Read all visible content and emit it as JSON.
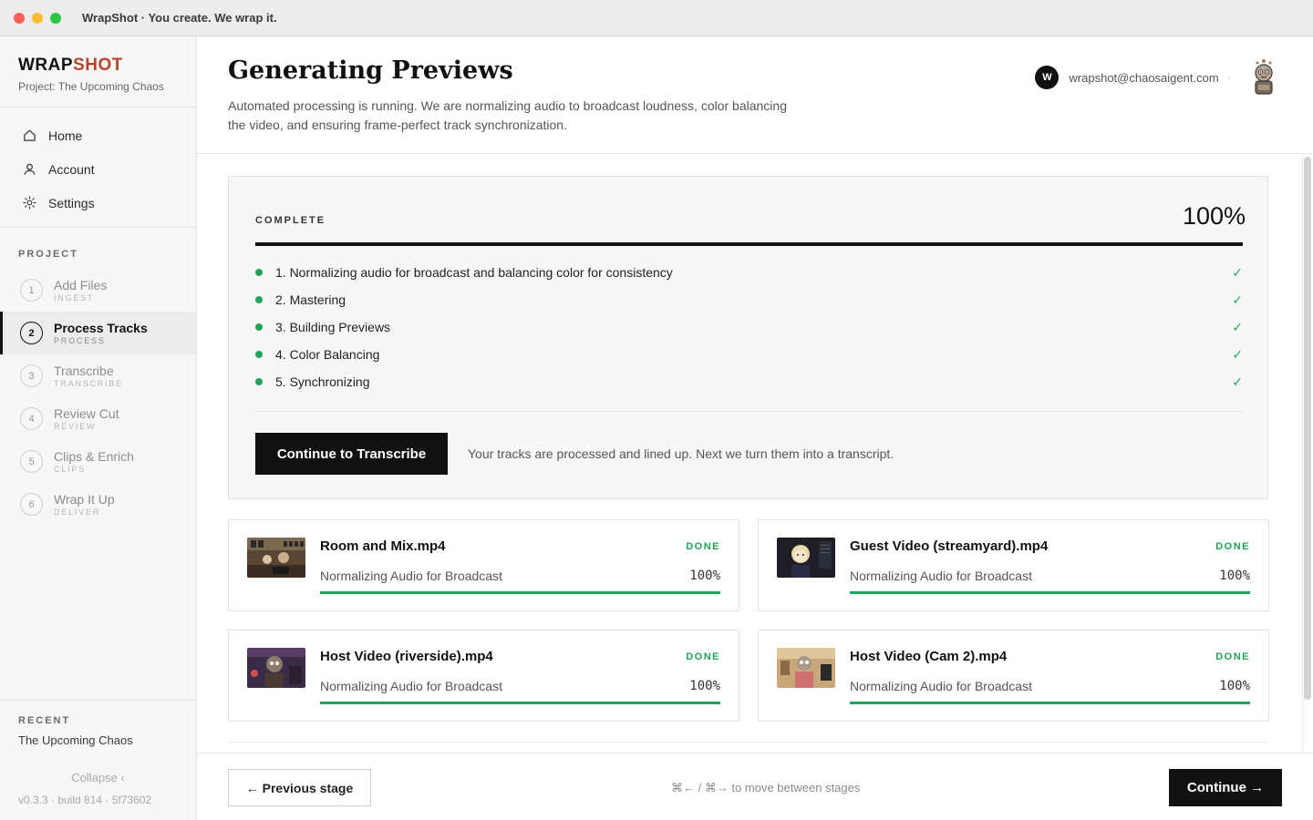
{
  "window": {
    "title": "WrapShot · You create. We wrap it."
  },
  "sidebar": {
    "brand_part1": "WRAP",
    "brand_part2": "SHOT",
    "project": "Project: The Upcoming Chaos",
    "nav": [
      {
        "label": "Home",
        "icon": "home-icon"
      },
      {
        "label": "Account",
        "icon": "user-icon"
      },
      {
        "label": "Settings",
        "icon": "gear-icon"
      }
    ],
    "section_label": "PROJECT",
    "stages": [
      {
        "num": "1",
        "name": "Add Files",
        "sub": "INGEST"
      },
      {
        "num": "2",
        "name": "Process Tracks",
        "sub": "PROCESS",
        "active": true
      },
      {
        "num": "3",
        "name": "Transcribe",
        "sub": "TRANSCRIBE"
      },
      {
        "num": "4",
        "name": "Review Cut",
        "sub": "REVIEW"
      },
      {
        "num": "5",
        "name": "Clips & Enrich",
        "sub": "CLIPS"
      },
      {
        "num": "6",
        "name": "Wrap It Up",
        "sub": "DELIVER"
      }
    ],
    "recent_label": "RECENT",
    "recent_item": "The Upcoming Chaos",
    "collapse": "Collapse ‹",
    "version": "v0.3.3 · build 814 · 5f73602"
  },
  "header": {
    "title": "Generating Previews",
    "description": "Automated processing is running. We are normalizing audio to broadcast loudness, color balancing the video, and ensuring frame-perfect track synchronization.",
    "user_initial": "W",
    "user_email": "wrapshot@chaosaigent.com",
    "user_sep": "·"
  },
  "progress": {
    "status": "COMPLETE",
    "percent": "100%",
    "fraction": 1.0,
    "steps": [
      "1. Normalizing audio for broadcast and balancing color for consistency",
      "2. Mastering",
      "3. Building Previews",
      "4. Color Balancing",
      "5. Synchronizing"
    ],
    "continue_label": "Continue to Transcribe",
    "note": "Your tracks are processed and lined up. Next we turn them into a transcript."
  },
  "tracks": [
    {
      "name": "Room and Mix.mp4",
      "status": "DONE",
      "task": "Normalizing Audio for Broadcast",
      "percent": "100%",
      "fraction": 1.0
    },
    {
      "name": "Guest Video (streamyard).mp4",
      "status": "DONE",
      "task": "Normalizing Audio for Broadcast",
      "percent": "100%",
      "fraction": 1.0
    },
    {
      "name": "Host Video (riverside).mp4",
      "status": "DONE",
      "task": "Normalizing Audio for Broadcast",
      "percent": "100%",
      "fraction": 1.0
    },
    {
      "name": "Host Video (Cam 2).mp4",
      "status": "DONE",
      "task": "Normalizing Audio for Broadcast",
      "percent": "100%",
      "fraction": 1.0
    }
  ],
  "footer": {
    "prev_label": "← Previous stage",
    "hint": "⌘← / ⌘→ to move between stages",
    "continue_label": "Continue →"
  },
  "colors": {
    "accent_brand": "#b5442c",
    "success": "#22a35a",
    "primary": "#111111"
  }
}
